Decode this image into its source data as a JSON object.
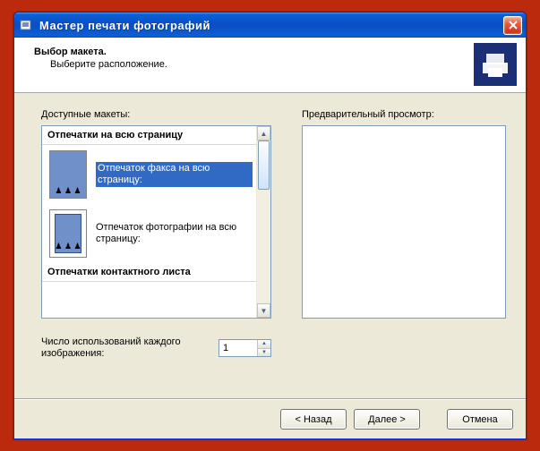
{
  "window": {
    "title": "Мастер печати фотографий"
  },
  "banner": {
    "heading": "Выбор макета.",
    "sub": "Выберите расположение."
  },
  "left": {
    "label": "Доступные макеты:",
    "group1": "Отпечатки на всю страницу",
    "item1": "Отпечаток факса на всю страницу:",
    "item2": "Отпечаток фотографии на всю страницу:",
    "group2": "Отпечатки контактного листа"
  },
  "right": {
    "label": "Предварительный просмотр:"
  },
  "usage": {
    "label": "Число использований каждого изображения:",
    "value": "1"
  },
  "buttons": {
    "back": "< Назад",
    "next": "Далее >",
    "cancel": "Отмена"
  }
}
